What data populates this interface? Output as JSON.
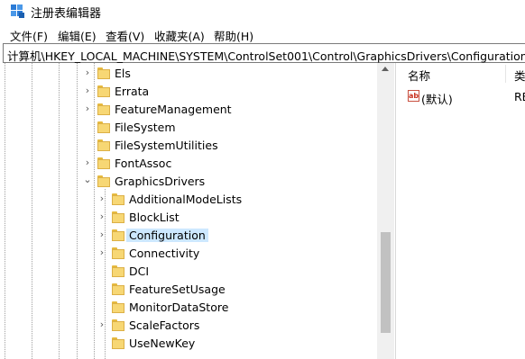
{
  "window": {
    "title": "注册表编辑器"
  },
  "menu": [
    "文件(F)",
    "编辑(E)",
    "查看(V)",
    "收藏夹(A)",
    "帮助(H)"
  ],
  "address": "计算机\\HKEY_LOCAL_MACHINE\\SYSTEM\\ControlSet001\\Control\\GraphicsDrivers\\Configuration",
  "tree": {
    "items": [
      {
        "label": "Els"
      },
      {
        "label": "Errata"
      },
      {
        "label": "FeatureManagement"
      },
      {
        "label": "FileSystem"
      },
      {
        "label": "FileSystemUtilities"
      },
      {
        "label": "FontAssoc"
      },
      {
        "label": "GraphicsDrivers"
      },
      {
        "label": "AdditionalModeLists"
      },
      {
        "label": "BlockList"
      },
      {
        "label": "Configuration"
      },
      {
        "label": "Connectivity"
      },
      {
        "label": "DCI"
      },
      {
        "label": "FeatureSetUsage"
      },
      {
        "label": "MonitorDataStore"
      },
      {
        "label": "ScaleFactors"
      },
      {
        "label": "UseNewKey"
      }
    ]
  },
  "list": {
    "columns": [
      "名称",
      "类"
    ],
    "rows": [
      {
        "icon": "ab",
        "name": "(默认)",
        "type": "RE"
      }
    ]
  }
}
